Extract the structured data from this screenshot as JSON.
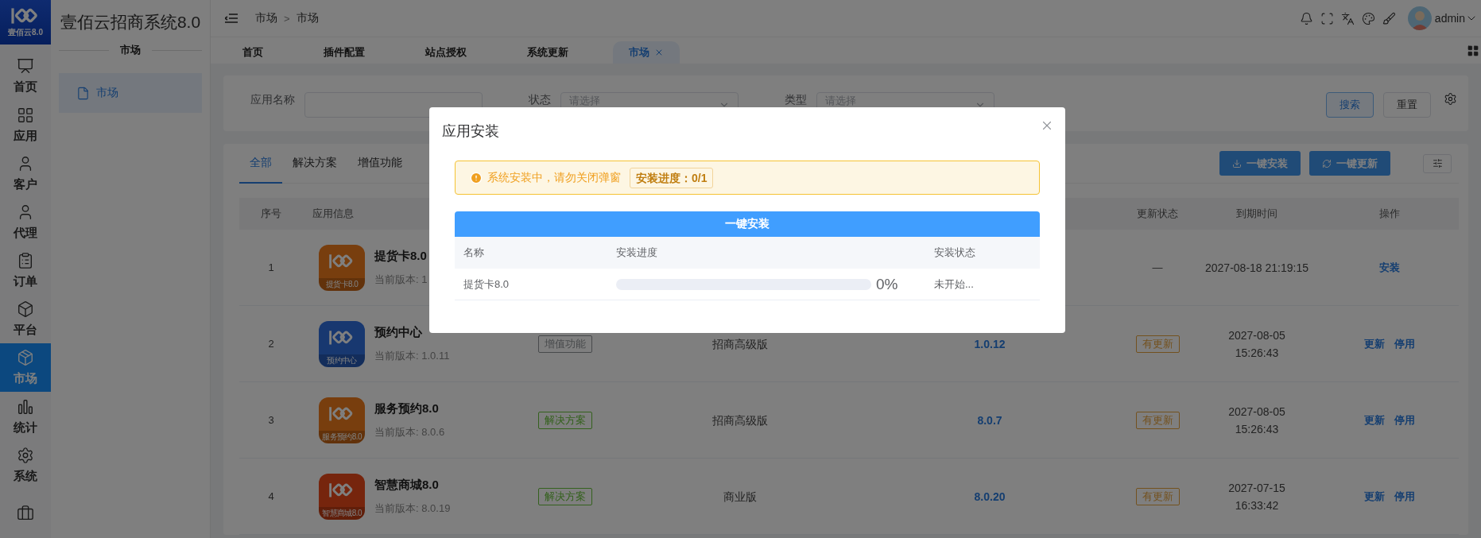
{
  "rail": {
    "logo_text": "壹佰云8.0",
    "items": [
      {
        "label": "首页",
        "selected": false
      },
      {
        "label": "应用",
        "selected": false
      },
      {
        "label": "客户",
        "selected": false
      },
      {
        "label": "代理",
        "selected": false
      },
      {
        "label": "订单",
        "selected": false
      },
      {
        "label": "平台",
        "selected": false
      },
      {
        "label": "市场",
        "selected": true
      },
      {
        "label": "统计",
        "selected": false
      },
      {
        "label": "系统",
        "selected": false
      },
      {
        "selected": false
      }
    ]
  },
  "sidebar": {
    "title": "壹佰云招商系统8.0",
    "section": "市场",
    "items": [
      {
        "label": "市场",
        "selected": true
      }
    ]
  },
  "header": {
    "breadcrumb": [
      "市场",
      "市场"
    ],
    "separator": ">",
    "user": "admin"
  },
  "tabs": [
    {
      "label": "首页",
      "selected": false,
      "closable": false
    },
    {
      "label": "插件配置",
      "selected": false,
      "closable": false
    },
    {
      "label": "站点授权",
      "selected": false,
      "closable": false
    },
    {
      "label": "系统更新",
      "selected": false,
      "closable": false
    },
    {
      "label": "市场",
      "selected": true,
      "closable": true
    }
  ],
  "filters": [
    {
      "label": "应用名称",
      "kind": "input"
    },
    {
      "label": "状态",
      "kind": "select",
      "placeholder": "请选择"
    },
    {
      "label": "类型",
      "kind": "select",
      "placeholder": "请选择"
    }
  ],
  "filter_buttons": [
    {
      "label": "搜索",
      "kind": "primary"
    },
    {
      "label": "重置",
      "kind": "default"
    }
  ],
  "table_tabs": [
    {
      "label": "全部",
      "selected": true
    },
    {
      "label": "解决方案",
      "selected": false
    },
    {
      "label": "增值功能",
      "selected": false
    }
  ],
  "actions": [
    "一键安装",
    "一键更新"
  ],
  "table": {
    "columns": [
      "序号",
      "应用信息",
      "更新状态",
      "到期时间",
      "操作"
    ],
    "rows": [
      {
        "index": "1",
        "name": "提货卡8.0",
        "icon_caption": "提货卡8.0",
        "color": "#783e0e",
        "version": "当前版本: 1",
        "update_status": {
          "kind": "none",
          "text": "—"
        },
        "expiry": [
          "2027-08-18 21:19:15"
        ],
        "actions": [
          "安装"
        ]
      },
      {
        "index": "2",
        "name": "预约中心",
        "icon_caption": "预约中心",
        "color": "#183870",
        "version": "当前版本: 1.0.11",
        "tag": {
          "text": "增值功能",
          "color": "#484a4c"
        },
        "edition": "招商高级版",
        "latest": "1.0.12",
        "update_status": {
          "kind": "tag",
          "text": "有更新",
          "color": "#73511e"
        },
        "expiry": [
          "2027-08-05",
          "15:26:43"
        ],
        "actions": [
          "更新",
          "停用"
        ]
      },
      {
        "index": "3",
        "name": "服务预约8.0",
        "icon_caption": "服务预约8.0",
        "color": "#783e0e",
        "version": "当前版本: 8.0.6",
        "tag": {
          "text": "解决方案",
          "color": "#34611d"
        },
        "edition": "招商高级版",
        "latest": "8.0.7",
        "update_status": {
          "kind": "tag",
          "text": "有更新",
          "color": "#73511e"
        },
        "expiry": [
          "2027-08-05",
          "15:26:43"
        ],
        "actions": [
          "更新",
          "停用"
        ]
      },
      {
        "index": "4",
        "name": "智慧商城8.0",
        "icon_caption": "智慧商城8.0",
        "color": "#76250d",
        "version": "当前版本: 8.0.19",
        "tag": {
          "text": "解决方案",
          "color": "#34611d"
        },
        "edition": "商业版",
        "latest": "8.0.20",
        "update_status": {
          "kind": "tag",
          "text": "有更新",
          "color": "#73511e"
        },
        "expiry": [
          "2027-07-15",
          "16:33:42"
        ],
        "actions": [
          "更新",
          "停用"
        ]
      }
    ]
  },
  "modal": {
    "title": "应用安装",
    "alert": {
      "message": "系统安装中，请勿关闭弹窗",
      "progress": "安装进度：0/1"
    },
    "button": "一键安装",
    "columns": [
      "名称",
      "安装进度",
      "安装状态"
    ],
    "rows": [
      {
        "name": "提货卡8.0",
        "percent": "0%",
        "status": "未开始..."
      }
    ]
  }
}
